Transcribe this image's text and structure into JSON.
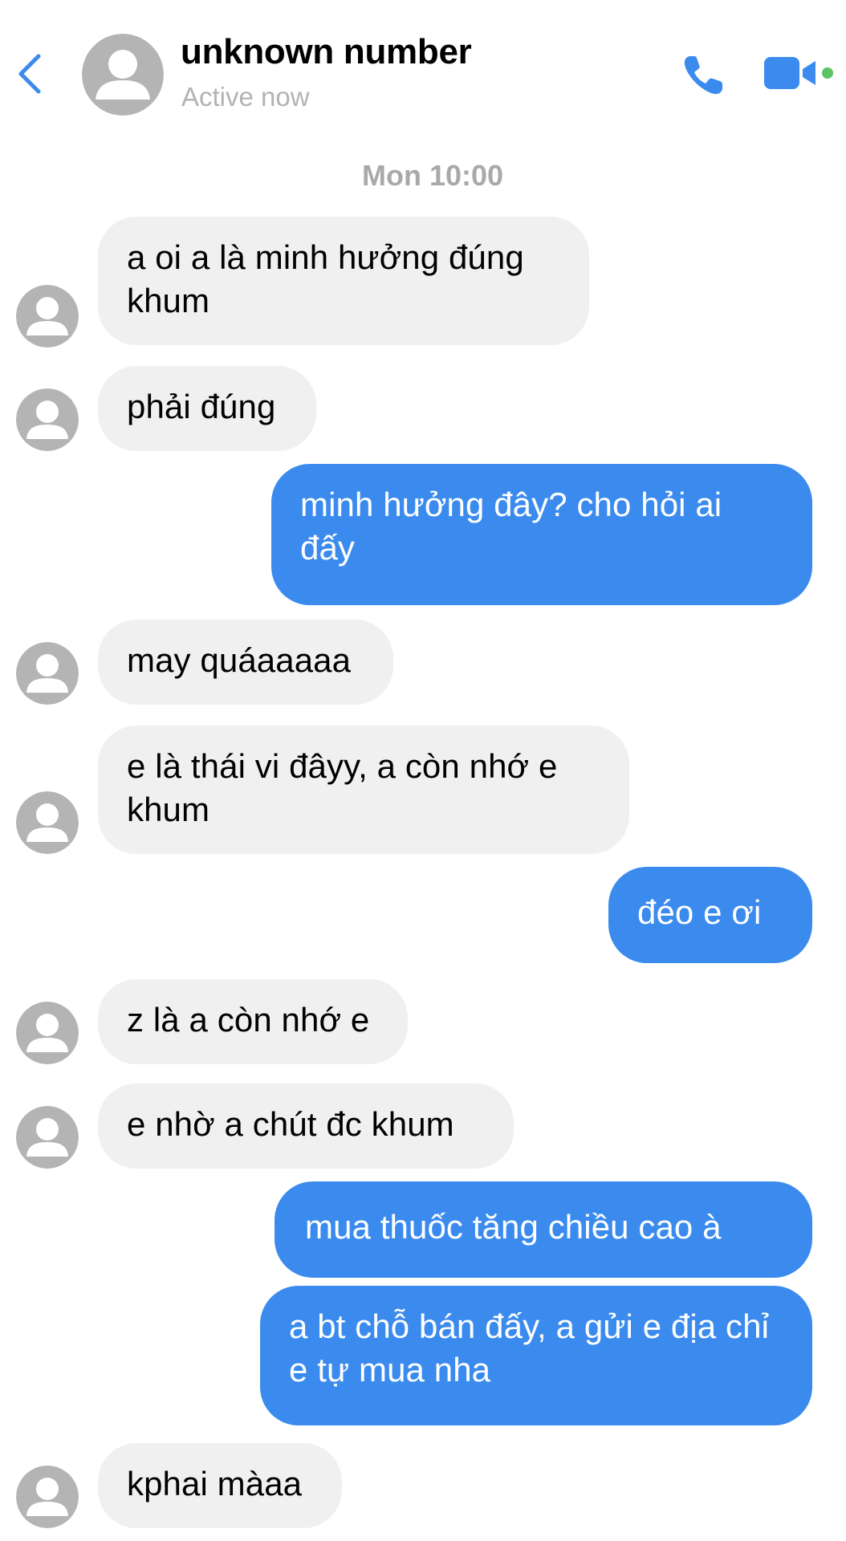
{
  "header": {
    "contact_name": "unknown number",
    "status": "Active now",
    "back_icon": "chevron-left-icon",
    "call_icon": "phone-icon",
    "video_icon": "video-camera-icon"
  },
  "conversation": {
    "timestamp": "Mon 10:00",
    "messages": [
      {
        "from": "them",
        "text": "a oi a là minh hưởng đúng khum"
      },
      {
        "from": "them",
        "text": "phải đúng"
      },
      {
        "from": "me",
        "text": "minh hưởng đây? cho hỏi ai đấy"
      },
      {
        "from": "them",
        "text": "may quáaaaaa"
      },
      {
        "from": "them",
        "text": "e là thái vi đâyy, a còn nhớ e khum"
      },
      {
        "from": "me",
        "text": "đéo e ơi"
      },
      {
        "from": "them",
        "text": "z là a còn nhớ e"
      },
      {
        "from": "them",
        "text": "e nhờ a chút đc khum"
      },
      {
        "from": "me",
        "text": "mua thuốc tăng chiều cao à"
      },
      {
        "from": "me",
        "text": "a bt chỗ bán đấy, a gửi e địa chỉ e tự mua nha"
      },
      {
        "from": "them",
        "text": "kphai màaa"
      }
    ]
  },
  "colors": {
    "accent": "#3b8bee",
    "received_bubble": "#f0f0f0",
    "online": "#5bc363",
    "muted_text": "#a9a9a9"
  }
}
